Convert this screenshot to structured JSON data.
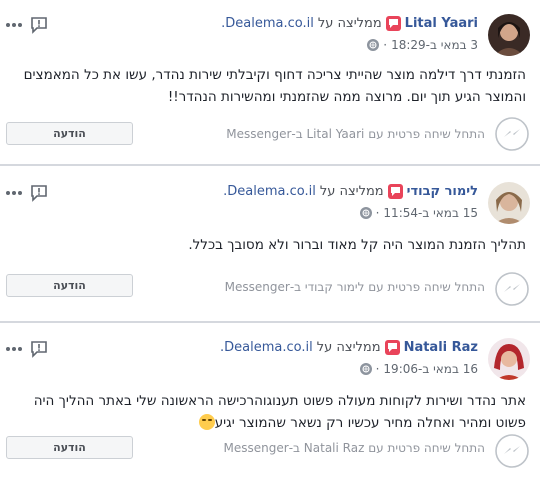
{
  "common": {
    "recommends": "ממליצה על",
    "site": "Dealema.co.il.",
    "send_label": "הודעה",
    "more_icon": "more-dots-icon",
    "report_icon": "report-flag-icon",
    "messenger_icon": "messenger-icon",
    "accent": "#365899"
  },
  "reviews": [
    {
      "name": "Lital Yaari",
      "time": "3 במאי ב-18:29",
      "text": "הזמנתי דרך דילמה מוצר שהייתי צריכה דחוף וקיבלתי שירות נהדר, עשו את כל המאמצים והמוצר הגיע תוך יום. מרוצה ממה שהזמנתי ומהשירות הנהדר!!",
      "messenger_text": "התחל שיחה פרטית עם Lital Yaari ב-Messenger"
    },
    {
      "name": "לימור קבודי",
      "time": "15 במאי ב-11:54",
      "text": "תהליך הזמנת המוצר היה קל מאוד וברור ולא מסובך בכלל.",
      "messenger_text": "התחל שיחה פרטית עם לימור קבודי ב-Messenger"
    },
    {
      "name": "Natali Raz",
      "time": "16 במאי ב-19:06",
      "text": "אתר נהדר ושירות לקוחות מעולה פשוט תענוגוהרכישה הראשונה שלי באתר ההליך היה פשוט ומהיר ואחלה מחיר עכשיו רק נשאר שהמוצר יגיע",
      "messenger_text": "התחל שיחה פרטית עם Natali Raz ב-Messenger"
    }
  ]
}
